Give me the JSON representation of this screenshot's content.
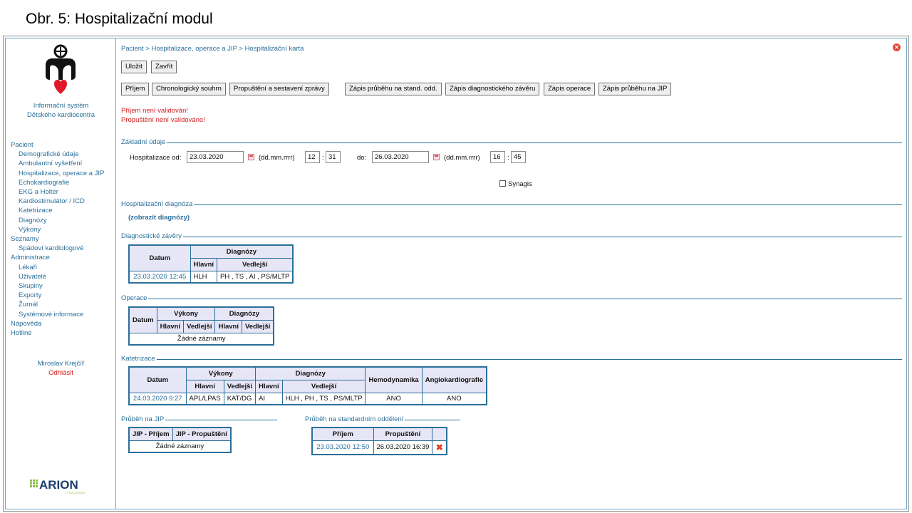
{
  "slide_title": "Obr. 5: Hospitalizační modul",
  "sidebar": {
    "system_name_line1": "Informační systém",
    "system_name_line2": "Dětského kardiocentra",
    "nav": [
      {
        "label": "Pacient",
        "level": 0
      },
      {
        "label": "Demografické údaje",
        "level": 1
      },
      {
        "label": "Ambulantní vyšetření",
        "level": 1
      },
      {
        "label": "Hospitalizace, operace a JIP",
        "level": 1
      },
      {
        "label": "Echokardiografie",
        "level": 1
      },
      {
        "label": "EKG a Holter",
        "level": 1
      },
      {
        "label": "Kardiostimulátor / ICD",
        "level": 1
      },
      {
        "label": "Katetrizace",
        "level": 1
      },
      {
        "label": "Diagnózy",
        "level": 1
      },
      {
        "label": "Výkony",
        "level": 1
      },
      {
        "label": "Seznamy",
        "level": 0
      },
      {
        "label": "Spádoví kardiologové",
        "level": 1
      },
      {
        "label": "Administrace",
        "level": 0
      },
      {
        "label": "Lékaři",
        "level": 1
      },
      {
        "label": "Uživatelé",
        "level": 1
      },
      {
        "label": "Skupiny",
        "level": 1
      },
      {
        "label": "Exporty",
        "level": 1
      },
      {
        "label": "Žurnál",
        "level": 1
      },
      {
        "label": "Systémové informace",
        "level": 1
      },
      {
        "label": "Nápověda",
        "level": 0
      },
      {
        "label": "Hotline",
        "level": 0
      }
    ],
    "user_name": "Miroslav Krejčíř",
    "logout": "Odhlásit",
    "brand": "ARION",
    "brand_sub": "IT SOLUTIONS"
  },
  "main": {
    "breadcrumb": "Pacient > Hospitalizace, operace a JIP > Hospitalizační karta",
    "buttons_top": {
      "save": "Uložit",
      "close": "Zavřít"
    },
    "buttons_row": [
      "Příjem",
      "Chronologický souhrn",
      "Propuštění a sestavení zprávy",
      "Zápis průběhu na stand. odd.",
      "Zápis diagnostického závěru",
      "Zápis operace",
      "Zápis průběhu na JIP"
    ],
    "messages": [
      "Příjem není validován!",
      "Propuštění není validováno!"
    ],
    "basic": {
      "legend": "Základní údaje",
      "from_label": "Hospitalizace od:",
      "from_date": "23.03.2020",
      "format_hint": "(dd.mm.rrrr)",
      "from_hour": "12",
      "from_min": "31",
      "to_label": "do:",
      "to_date": "26.03.2020",
      "to_hour": "16",
      "to_min": "45",
      "colon": ":",
      "synagis": "Synagis"
    },
    "hosp_diag": {
      "legend": "Hospitalizační diagnóza",
      "link": "(zobrazit diagnózy)"
    },
    "diag_conclusions": {
      "legend": "Diagnostické závěry",
      "h_datum": "Datum",
      "h_diagnozy": "Diagnózy",
      "h_hlavni": "Hlavní",
      "h_vedlejsi": "Vedlejší",
      "row": {
        "datum": "23.03.2020 12:45",
        "hlavni": "HLH",
        "vedlejsi": "PH , TS , AI , PS/MLTP"
      }
    },
    "operations": {
      "legend": "Operace",
      "h_datum": "Datum",
      "h_vykony": "Výkony",
      "h_diagnozy": "Diagnózy",
      "h_hlavni": "Hlavní",
      "h_vedlejsi": "Vedlejší",
      "empty": "Žádné záznamy"
    },
    "catheterization": {
      "legend": "Katetrizace",
      "h_datum": "Datum",
      "h_vykony": "Výkony",
      "h_diagnozy": "Diagnózy",
      "h_hlavni": "Hlavní",
      "h_vedlejsi": "Vedlejší",
      "h_hemo": "Hemodynamika",
      "h_angio": "Angiokardiografie",
      "row": {
        "datum": "24.03.2020 9:27",
        "vyk_hlavni": "APL/LPAS",
        "vyk_vedlejsi": "KAT/DG",
        "diag_hlavni": "AI",
        "diag_vedlejsi": "HLH , PH , TS , PS/MLTP",
        "hemo": "ANO",
        "angio": "ANO"
      }
    },
    "icu": {
      "legend": "Průběh na JIP",
      "h_in": "JIP - Příjem",
      "h_out": "JIP - Propuštění",
      "empty": "Žádné záznamy"
    },
    "ward": {
      "legend": "Průběh na standardním oddělení",
      "h_in": "Příjem",
      "h_out": "Propuštění",
      "row": {
        "in": "23.03.2020 12:50",
        "out": "26.03.2020 16:39"
      }
    }
  }
}
